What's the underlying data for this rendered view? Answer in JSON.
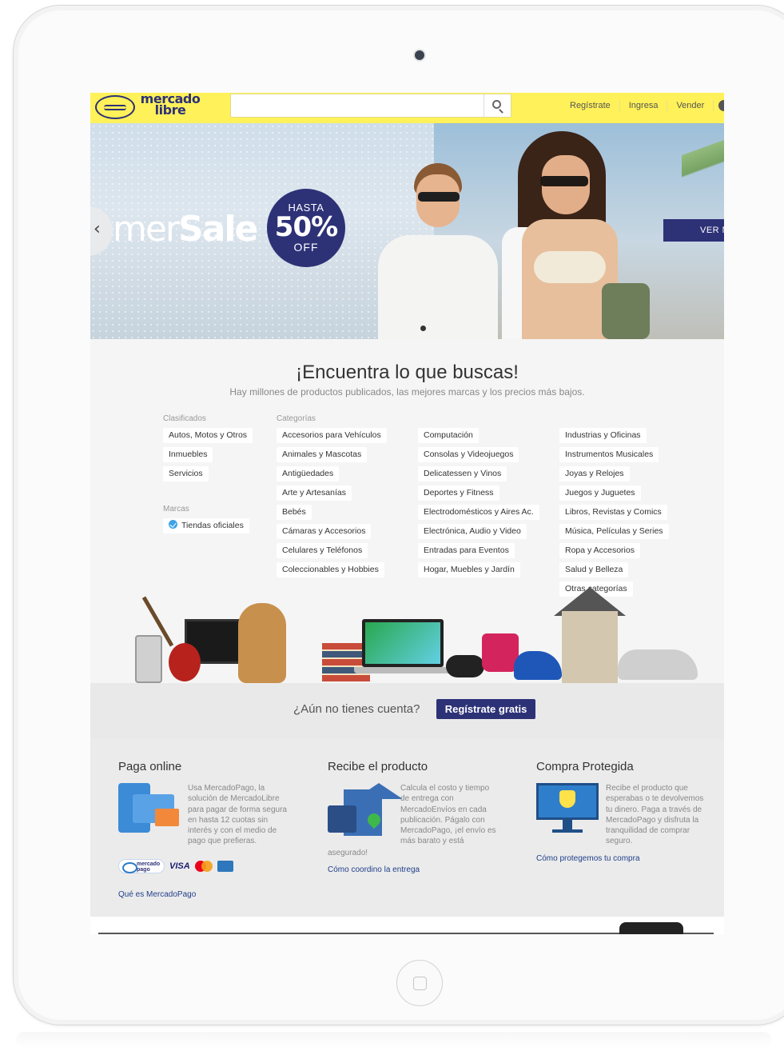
{
  "header": {
    "logo_line1": "mercado",
    "logo_line2": "libre",
    "search_placeholder": "",
    "nav": [
      "Regístrate",
      "Ingresa",
      "Vender"
    ]
  },
  "hero": {
    "sale_text_light": "mer",
    "sale_text_bold": "Sale",
    "badge_top": "HASTA",
    "badge_pct": "50%",
    "badge_off": "OFF",
    "cta": "VER M",
    "prev_arrow": "‹"
  },
  "find": {
    "title": "¡Encuentra lo que buscas!",
    "subtitle": "Hay millones de productos publicados, las mejores marcas y los precios más bajos.",
    "clasificados_label": "Clasificados",
    "clasificados": [
      "Autos, Motos y Otros",
      "Inmuebles",
      "Servicios"
    ],
    "marcas_label": "Marcas",
    "marcas": [
      "Tiendas oficiales"
    ],
    "categorias_label": "Categorías",
    "categorias_col1": [
      "Accesorios para Vehículos",
      "Animales y Mascotas",
      "Antigüedades",
      "Arte y Artesanías",
      "Bebés",
      "Cámaras y Accesorios",
      "Celulares y Teléfonos",
      "Coleccionables y Hobbies"
    ],
    "categorias_col2": [
      "Computación",
      "Consolas y Videojuegos",
      "Delicatessen y Vinos",
      "Deportes y Fitness",
      "Electrodomésticos y Aires Ac.",
      "Electrónica, Audio y Video",
      "Entradas para Eventos",
      "Hogar, Muebles y Jardín"
    ],
    "categorias_col3": [
      "Industrias y Oficinas",
      "Instrumentos Musicales",
      "Joyas y Relojes",
      "Juegos y Juguetes",
      "Libros, Revistas y Comics",
      "Música, Películas y Series",
      "Ropa y Accesorios",
      "Salud y Belleza",
      "Otras categorías"
    ]
  },
  "signup": {
    "question": "¿Aún no tienes cuenta?",
    "button": "Regístrate gratis"
  },
  "features": {
    "pay": {
      "title": "Paga online",
      "desc": "Usa MercadoPago, la solución de MercadoLibre para pagar de forma segura en hasta 12 cuotas sin interés y con el medio de pago que prefieras.",
      "link": "Qué es MercadoPago",
      "logo_mp": "mercado pago",
      "logo_visa": "VISA"
    },
    "ship": {
      "title": "Recibe el producto",
      "desc": "Calcula el costo y tiempo de entrega con MercadoEnvíos en cada publicación. Págalo con MercadoPago, ¡el envío es más barato y está",
      "desc_tail": "asegurado!",
      "link": "Cómo coordino la entrega"
    },
    "protect": {
      "title": "Compra Protegida",
      "desc": "Recibe el producto que esperabas o te devolvemos tu dinero. Paga a través de MercadoPago y disfruta la tranquilidad de comprar seguro.",
      "link": "Cómo protegemos tu compra"
    }
  },
  "colors": {
    "brand_yellow": "#fff159",
    "brand_blue": "#2d3277",
    "link_blue": "#1f3f8a"
  }
}
